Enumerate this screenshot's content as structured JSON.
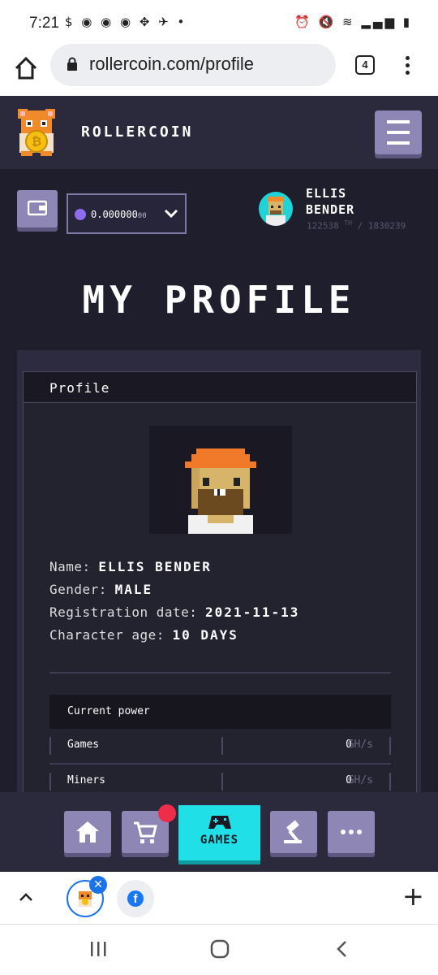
{
  "status_bar": {
    "time": "7:21",
    "notification_icons": [
      "money-bag-icon",
      "chrome-icon",
      "chrome-icon",
      "chrome-icon",
      "tiktok-icon",
      "telegram-icon",
      "dot-icon"
    ],
    "notification_glyphs": "$ ◉ ◉ ◉ ✥ ✈ •",
    "system_icons": [
      "alarm-icon",
      "mute-icon",
      "wifi-icon",
      "signal-icon",
      "battery-icon"
    ],
    "system_glyphs": "⏰ 🔇 ≋ ▂▄▆ ▮"
  },
  "browser": {
    "url": "rollercoin.com/profile",
    "tab_count": "4"
  },
  "site": {
    "brand": "ROLLERCOIN"
  },
  "wallet": {
    "balance_main": "0.000000",
    "balance_tail": "00",
    "currency_icon": "eth-icon"
  },
  "user": {
    "name_line1": "ELLIS",
    "name_line2": "BENDER",
    "power_current": "122538",
    "power_sup": "TH",
    "power_total": "/ 1830239"
  },
  "page": {
    "title": "MY PROFILE"
  },
  "profile": {
    "header": "Profile",
    "fields": [
      {
        "label": "Name:",
        "value": "ELLIS BENDER"
      },
      {
        "label": "Gender:",
        "value": "MALE"
      },
      {
        "label": "Registration date:",
        "value": "2021-11-13"
      },
      {
        "label": "Character age:",
        "value": "10 DAYS"
      }
    ],
    "power_header": "Current power",
    "power_rows": [
      {
        "label": "Games",
        "value": "0",
        "unit": "GH/s"
      },
      {
        "label": "Miners",
        "value": "0",
        "unit": "GH/s"
      }
    ]
  },
  "bottom_nav": {
    "games_label": "GAMES"
  },
  "colors": {
    "background": "#1f1e2d",
    "header": "#2b2a3d",
    "button_purple": "#8e86b5",
    "games_cyan": "#20dfe6",
    "badge_red": "#ee2d4a"
  }
}
